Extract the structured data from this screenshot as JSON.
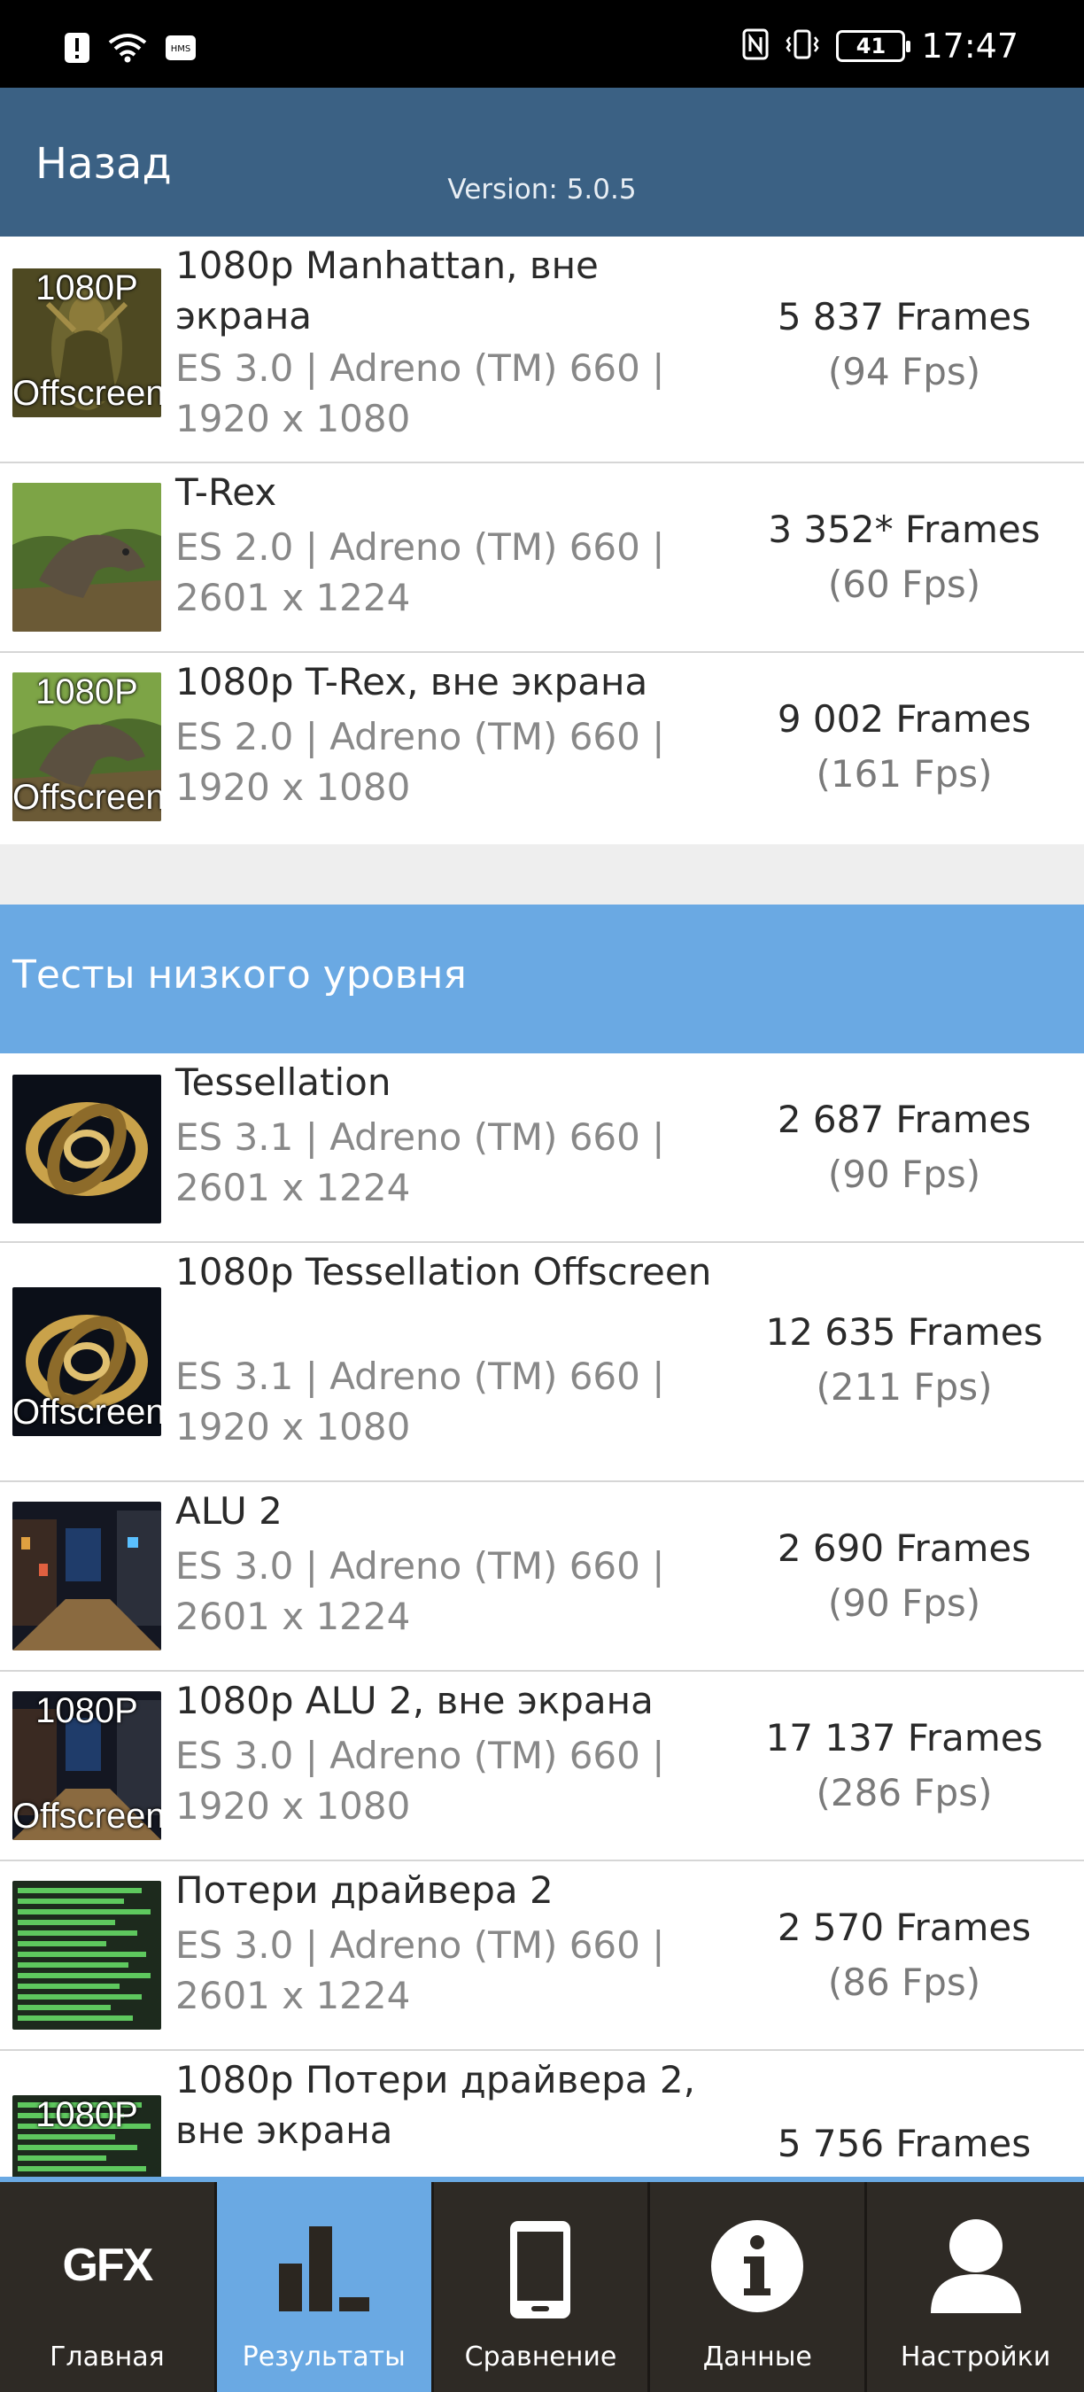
{
  "status_bar": {
    "time": "17:47",
    "battery": "41",
    "left_icons": [
      "alert-icon",
      "wifi-icon",
      "hms-icon"
    ],
    "hms_label": "HMS",
    "right_icons": [
      "nfc-icon",
      "vibrate-icon",
      "battery-icon"
    ]
  },
  "header": {
    "back_label": "Назад",
    "version": "Version: 5.0.5"
  },
  "results": [
    {
      "title": "1080p Manhattan, вне экрана",
      "meta": "ES 3.0 | Adreno (TM) 660 | 1920 x 1080",
      "frames": "5 837 Frames",
      "fps": "(94 Fps)",
      "thumb": "manhattan",
      "badge_top": "1080P",
      "badge_bottom": "Offscreen"
    },
    {
      "title": "T-Rex",
      "meta": "ES 2.0 | Adreno (TM) 660 | 2601 x 1224",
      "frames": "3 352* Frames",
      "fps": "(60 Fps)",
      "thumb": "trex"
    },
    {
      "title": "1080p T-Rex, вне экрана",
      "meta": "ES 2.0 | Adreno (TM) 660 | 1920 x 1080",
      "frames": "9 002 Frames",
      "fps": "(161 Fps)",
      "thumb": "trex",
      "badge_top": "1080P",
      "badge_bottom": "Offscreen"
    }
  ],
  "section": {
    "title": "Тесты низкого уровня"
  },
  "low_level": [
    {
      "title": "Tessellation",
      "meta": "ES 3.1 | Adreno (TM) 660 | 2601 x 1224",
      "frames": "2 687 Frames",
      "fps": "(90 Fps)",
      "thumb": "tessellation"
    },
    {
      "title": "1080p Tessellation Offscreen",
      "meta": "ES 3.1 | Adreno (TM) 660 | 1920 x 1080",
      "frames": "12 635 Frames",
      "fps": "(211 Fps)",
      "thumb": "tessellation",
      "badge_bottom": "Offscreen"
    },
    {
      "title": "ALU 2",
      "meta": "ES 3.0 | Adreno (TM) 660 | 2601 x 1224",
      "frames": "2 690 Frames",
      "fps": "(90 Fps)",
      "thumb": "alu"
    },
    {
      "title": "1080p ALU 2, вне экрана",
      "meta": "ES 3.0 | Adreno (TM) 660 | 1920 x 1080",
      "frames": "17 137 Frames",
      "fps": "(286 Fps)",
      "thumb": "alu",
      "badge_top": "1080P",
      "badge_bottom": "Offscreen"
    },
    {
      "title": "Потери драйвера 2",
      "meta": "ES 3.0 | Adreno (TM) 660 | 2601 x 1224",
      "frames": "2 570 Frames",
      "fps": "(86 Fps)",
      "thumb": "driver"
    },
    {
      "title": "1080p Потери драйвера 2, вне экрана",
      "meta": "",
      "frames": "5 756 Frames",
      "fps": "",
      "thumb": "driver",
      "badge_top": "1080P"
    }
  ],
  "nav": [
    {
      "label": "Главная",
      "icon": "gfx-logo-icon",
      "logo_text": "GFX",
      "active": false
    },
    {
      "label": "Результаты",
      "icon": "bar-chart-icon",
      "active": true
    },
    {
      "label": "Сравнение",
      "icon": "phone-icon",
      "active": false
    },
    {
      "label": "Данные",
      "icon": "info-icon",
      "active": false
    },
    {
      "label": "Настройки",
      "icon": "user-icon",
      "active": false
    }
  ],
  "colors": {
    "header": "#3b6184",
    "section": "#6aa9e3",
    "nav_bg": "#2e2a25",
    "nav_active": "#6aa9e3"
  }
}
